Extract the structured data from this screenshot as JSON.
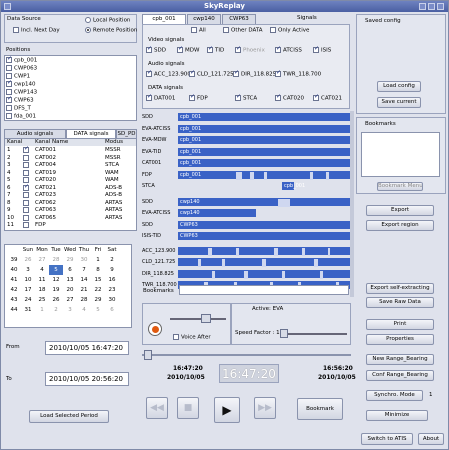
{
  "title": "SkyReplay",
  "data_source": {
    "label": "Data Source",
    "options": [
      "Local Position",
      "Remote Position",
      "Incl. Next Day"
    ],
    "selected": "Remote Position"
  },
  "positions": {
    "label": "Positions",
    "items": [
      {
        "name": "cpb_001",
        "checked": true
      },
      {
        "name": "CWP063",
        "checked": false
      },
      {
        "name": "CWP1",
        "checked": false
      },
      {
        "name": "cwp140",
        "checked": true
      },
      {
        "name": "CWP143",
        "checked": false
      },
      {
        "name": "CWP63",
        "checked": true
      },
      {
        "name": "DFS_T",
        "checked": false
      },
      {
        "name": "fda_001",
        "checked": false
      }
    ]
  },
  "left_tabs": [
    "Audio signals",
    "DATA signals",
    "SD_PD"
  ],
  "channel_table": {
    "headers": [
      "Kanal",
      "",
      "Kanal Name",
      "Modus"
    ],
    "rows": [
      [
        "1",
        "on",
        "CAT001",
        "MSSR"
      ],
      [
        "2",
        "",
        "CAT002",
        "MSSR"
      ],
      [
        "3",
        "",
        "CAT004",
        "STCA"
      ],
      [
        "4",
        "",
        "CAT019",
        "WAM"
      ],
      [
        "5",
        "",
        "CAT020",
        "WAM"
      ],
      [
        "6",
        "on",
        "CAT021",
        "ADS-B"
      ],
      [
        "7",
        "",
        "CAT023",
        "ADS-B"
      ],
      [
        "8",
        "",
        "CAT062",
        "ARTAS"
      ],
      [
        "9",
        "",
        "CAT063",
        "ARTAS"
      ],
      [
        "10",
        "",
        "CAT065",
        "ARTAS"
      ],
      [
        "11",
        "",
        "FDP",
        ""
      ]
    ]
  },
  "calendar": {
    "days": [
      "Sun",
      "Mon",
      "Tue",
      "Wed",
      "Thu",
      "Fri",
      "Sat"
    ],
    "weeks": [
      [
        "39",
        "26",
        "27",
        "28",
        "29",
        "30",
        "1",
        "2"
      ],
      [
        "40",
        "3",
        "4",
        "5",
        "6",
        "7",
        "8",
        "9"
      ],
      [
        "41",
        "10",
        "11",
        "12",
        "13",
        "14",
        "15",
        "16"
      ],
      [
        "42",
        "17",
        "18",
        "19",
        "20",
        "21",
        "22",
        "23"
      ],
      [
        "43",
        "24",
        "25",
        "26",
        "27",
        "28",
        "29",
        "30"
      ],
      [
        "44",
        "31",
        "1",
        "2",
        "3",
        "4",
        "5",
        "6"
      ]
    ],
    "selected": "5"
  },
  "from_label": "From",
  "from_value": "2010/10/05 16:47:20",
  "to_label": "To",
  "to_value": "2010/10/05 20:56:20",
  "load_period": "Load Selected Period",
  "center_tabs": [
    "cpb_001",
    "cwp140",
    "CWP63",
    "Signals"
  ],
  "filters": {
    "all": "All",
    "other_data": "Other DATA",
    "only_active": "Only Active"
  },
  "video_signals": {
    "label": "Video signals",
    "items": [
      "SDD",
      "MDW",
      "TID",
      "Phoenix",
      "ATCISS",
      "ISIS"
    ]
  },
  "audio_signals": {
    "label": "Audio signals",
    "items": [
      "ACC_123.900",
      "CLD_121.725",
      "DIR_118.825",
      "TWR_118.700"
    ]
  },
  "data_signals": {
    "label": "DATA signals",
    "items": [
      "DAT001",
      "FDP",
      "STCA",
      "CAT020",
      "CAT021"
    ]
  },
  "signal_rows": [
    {
      "name": "SDD",
      "label": "cpb_001"
    },
    {
      "name": "EVA-ATCISS",
      "label": "cpb_001"
    },
    {
      "name": "EVA-MDW",
      "label": "cpb_001"
    },
    {
      "name": "EVA-TID",
      "label": "cpb_001"
    },
    {
      "name": "CAT001",
      "label": "cpb_001"
    },
    {
      "name": "FDP",
      "label": "cpb_001"
    },
    {
      "name": "STCA",
      "label": "cpb_001"
    },
    {
      "name": "SDD",
      "label": "cwp140"
    },
    {
      "name": "EVA-ATCISS",
      "label": "cwp140"
    },
    {
      "name": "SDD",
      "label": "CWP63"
    },
    {
      "name": "ISIS-TID",
      "label": "CWP63"
    },
    {
      "name": "ACC_123.900",
      "label": ""
    },
    {
      "name": "CLD_121.725",
      "label": ""
    },
    {
      "name": "DIR_118.825",
      "label": ""
    },
    {
      "name": "TWR_118.700",
      "label": ""
    }
  ],
  "bookmarks_label": "Bookmarks",
  "active": "Active: EVA",
  "voice_after": "Voice After",
  "speed_factor": "Speed Factor : 1",
  "time_start": "16:47:20",
  "date_start": "2010/10/05",
  "time_current": "16:47:20",
  "time_end": "16:56:20",
  "date_end": "2010/10/05",
  "bookmark_btn": "Bookmark",
  "saved_config": "Saved config",
  "load_config": "Load config",
  "save_current": "Save current",
  "bookmarks_panel": "Bookmarks",
  "bookmark_menu": "Bookmark Menu",
  "export": "Export",
  "export_region": "Export region",
  "export_self": "Export self-extracting",
  "save_raw": "Save Raw Data",
  "print": "Print",
  "properties": "Properties",
  "new_range": "New Range_Bearing",
  "conf_range": "Conf Range_Bearing",
  "synchro_mode": "Synchro. Mode",
  "synchro_value": "1",
  "minimize": "Minimize",
  "switch_atis": "Switch to ATIS",
  "about": "About"
}
